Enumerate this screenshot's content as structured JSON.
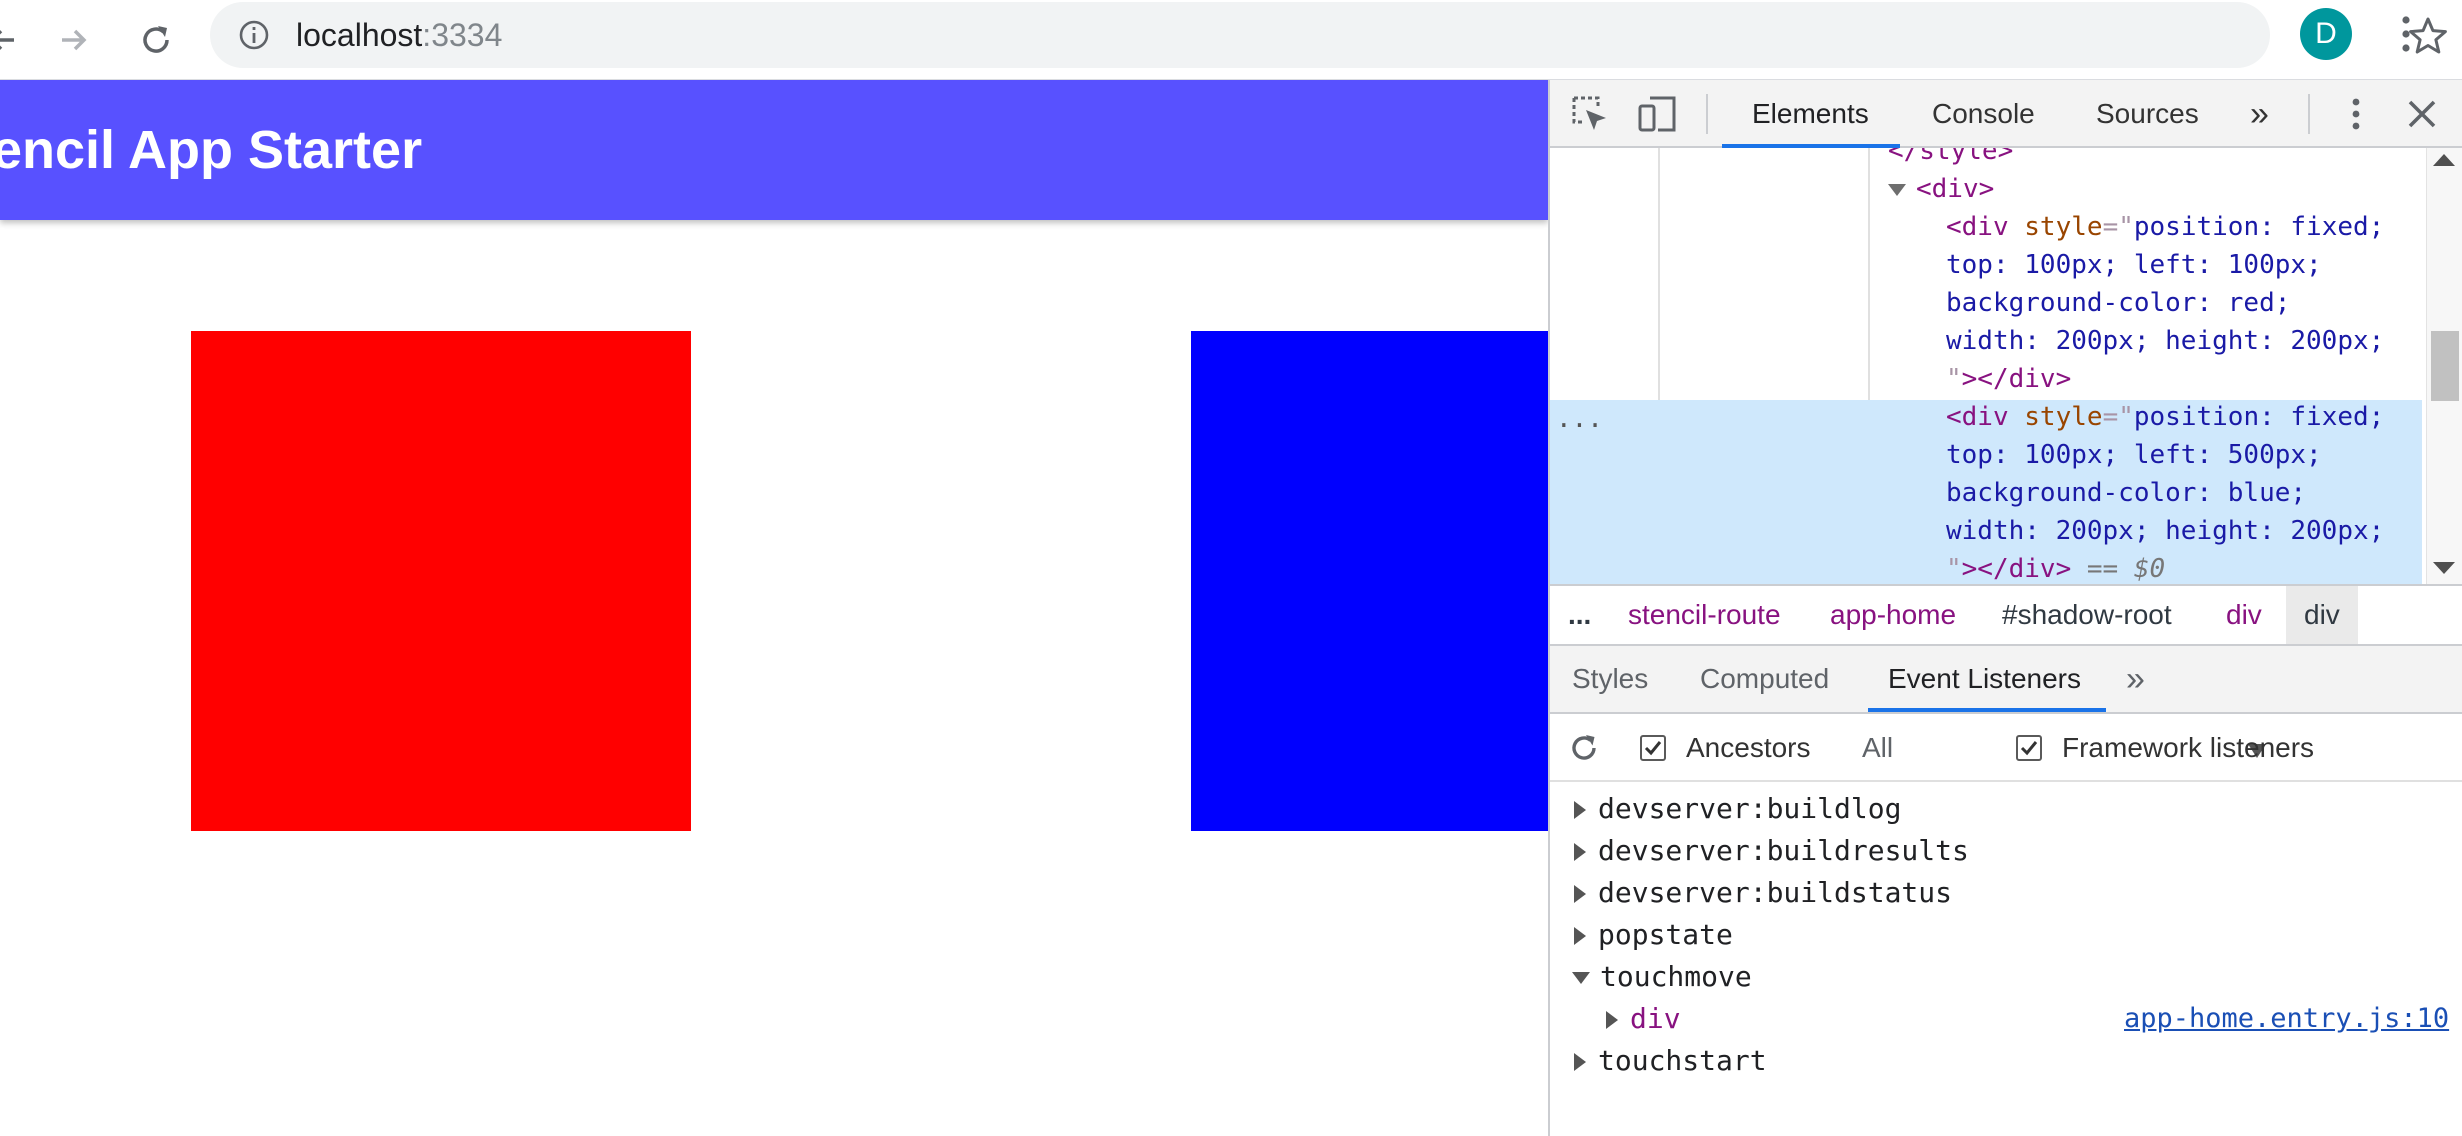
{
  "browser": {
    "url_host": "localhost",
    "url_port": ":3334",
    "profile_initial": "D",
    "colors": {
      "avatar": "#00979d",
      "omnibox": "#f1f3f4"
    },
    "icons": [
      "back-arrow-icon",
      "forward-arrow-icon",
      "reload-icon",
      "info-icon",
      "star-icon",
      "kebab-menu-icon"
    ]
  },
  "page": {
    "title": "tencil App Starter",
    "colors": {
      "header": "#5851ff",
      "red_box": "#ff0000",
      "blue_box": "#0000ff"
    }
  },
  "devtools": {
    "tabs": [
      {
        "label": "Elements",
        "active": true
      },
      {
        "label": "Console",
        "active": false
      },
      {
        "label": "Sources",
        "active": false
      }
    ],
    "more_tabs": "»",
    "dom_lines": {
      "style_close": "</style>",
      "div_open": "<div>",
      "red_div": {
        "open": "<div",
        "attr": "style",
        "line1": "position: fixed;",
        "line2": "top: 100px; left: 100px;",
        "line3": "background-color: red;",
        "line4": "width: 200px; height: 200px;",
        "close_quote": "\"",
        "close_tag": "></div>"
      },
      "blue_div": {
        "open": "<div",
        "attr": "style",
        "line1": "position: fixed;",
        "line2": "top: 100px; left: 500px;",
        "line3": "background-color: blue;",
        "line4": "width: 200px; height: 200px;",
        "close_quote": "\"",
        "close_tag": "></div>",
        "selection_marker": "== $0"
      },
      "ellipsis": "..."
    },
    "breadcrumb": [
      {
        "label": "...",
        "kind": "plain"
      },
      {
        "label": "stencil-route",
        "kind": "el"
      },
      {
        "label": "app-home",
        "kind": "el"
      },
      {
        "label": "#shadow-root",
        "kind": "plain"
      },
      {
        "label": "div",
        "kind": "el"
      },
      {
        "label": "div",
        "kind": "current"
      }
    ],
    "side_tabs": [
      {
        "label": "Styles",
        "active": false
      },
      {
        "label": "Computed",
        "active": false
      },
      {
        "label": "Event Listeners",
        "active": true
      }
    ],
    "side_more": "»",
    "listener_toolbar": {
      "ancestors_label": "Ancestors",
      "ancestors_checked": true,
      "filter_value": "All",
      "framework_label": "Framework listeners",
      "framework_checked": true
    },
    "listeners": [
      {
        "name": "devserver:buildlog",
        "expanded": false
      },
      {
        "name": "devserver:buildresults",
        "expanded": false
      },
      {
        "name": "devserver:buildstatus",
        "expanded": false
      },
      {
        "name": "popstate",
        "expanded": false
      },
      {
        "name": "touchmove",
        "expanded": true,
        "child": {
          "node": "div",
          "source": "app-home.entry.js:10"
        }
      },
      {
        "name": "touchstart",
        "expanded": false
      }
    ],
    "colors": {
      "selection": "#cfe8fc",
      "tag": "#881280",
      "attribute": "#994500",
      "value": "#1a1aa6",
      "active_tab": "#1a73e8",
      "link": "#1a4fb5"
    }
  }
}
